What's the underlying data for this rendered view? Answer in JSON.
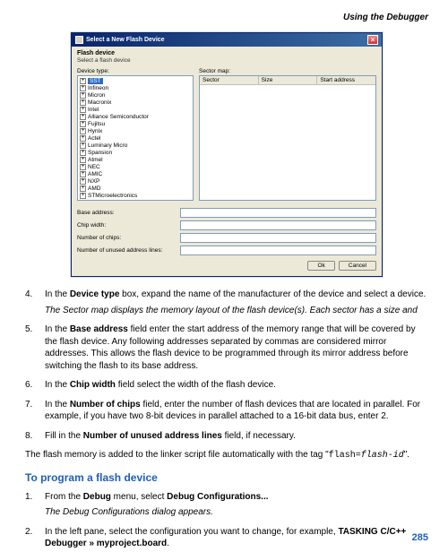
{
  "page": {
    "header": "Using the Debugger",
    "number": "285"
  },
  "dialog": {
    "title": "Select a New Flash Device",
    "section_title": "Flash device",
    "section_sub": "Select a flash device",
    "device_type_label": "Device type:",
    "sector_map_label": "Sector map:",
    "sector_cols": {
      "c1": "Sector",
      "c2": "Size",
      "c3": "Start address"
    },
    "tree_items": [
      "SST",
      "Infineon",
      "Micron",
      "Macronix",
      "Intel",
      "Alliance Semiconductor",
      "Fujitsu",
      "Hynix",
      "Actel",
      "Luminary Micro",
      "Spansion",
      "Atmel",
      "NEC",
      "AMIC",
      "NXP",
      "AMD",
      "STMicroelectronics"
    ],
    "base_address_label": "Base address:",
    "chip_width_label": "Chip width:",
    "num_chips_label": "Number of chips:",
    "unused_lines_label": "Number of unused address lines:",
    "ok": "Ok",
    "cancel": "Cancel"
  },
  "steps_a": [
    {
      "n": "4.",
      "pre": "In the ",
      "bold": "Device type",
      "post": " box, expand the name of the manufacturer of the device and select a device.",
      "note": "The Sector map displays the memory layout of the flash device(s). Each sector has a size and"
    },
    {
      "n": "5.",
      "pre": "In the ",
      "bold": "Base address",
      "post": " field enter the start address of the memory range that will be covered by the flash device. Any following addresses separated by commas are considered mirror addresses. This allows the flash device to be programmed through its mirror address before switching the flash to its base address."
    },
    {
      "n": "6.",
      "pre": "In the ",
      "bold": "Chip width",
      "post": " field select the width of the flash device."
    },
    {
      "n": "7.",
      "pre": "In the ",
      "bold": "Number of chips",
      "post": " field, enter the number of flash devices that are located in parallel. For example, if you have two 8-bit devices in parallel attached to a 16-bit data bus, enter 2."
    },
    {
      "n": "8.",
      "pre": "Fill in the ",
      "bold": "Number of unused address lines",
      "post": " field, if necessary."
    }
  ],
  "para_after": {
    "p1": "The flash memory is added to the linker script file automatically with the tag \"",
    "code": "flash=",
    "italic": "flash-id",
    "p2": "\"."
  },
  "heading2": "To program a flash device",
  "steps_b": [
    {
      "n": "1.",
      "pre": "From the ",
      "bold": "Debug",
      "mid": " menu, select ",
      "bold2": "Debug Configurations...",
      "note": "The Debug Configurations dialog appears."
    },
    {
      "n": "2.",
      "pre": "In the left pane, select the configuration you want to change, for example, ",
      "bold": "TASKING C/C++ Debugger » myproject.board",
      "post": "."
    }
  ]
}
